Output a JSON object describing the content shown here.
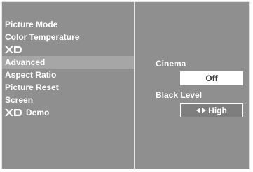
{
  "menu": {
    "items": [
      {
        "label": "Picture Mode",
        "type": "text",
        "active": false
      },
      {
        "label": "Color Temperature",
        "type": "text",
        "active": false
      },
      {
        "label": "XD",
        "type": "logo",
        "active": false
      },
      {
        "label": "Advanced",
        "type": "text",
        "active": true
      },
      {
        "label": "Aspect Ratio",
        "type": "text",
        "active": false
      },
      {
        "label": "Picture Reset",
        "type": "text",
        "active": false
      },
      {
        "label": "Screen",
        "type": "text",
        "active": false
      },
      {
        "label": "Demo",
        "type": "logo-text",
        "logo": "XD",
        "active": false
      }
    ]
  },
  "submenu": {
    "cinema": {
      "label": "Cinema",
      "value": "Off"
    },
    "black_level": {
      "label": "Black Level",
      "value": "High",
      "icon": "left-right-arrows-icon"
    }
  },
  "colors": {
    "osd_background": "#8f8f8f",
    "highlight": "#a6a6a6",
    "text": "#ffffff"
  }
}
